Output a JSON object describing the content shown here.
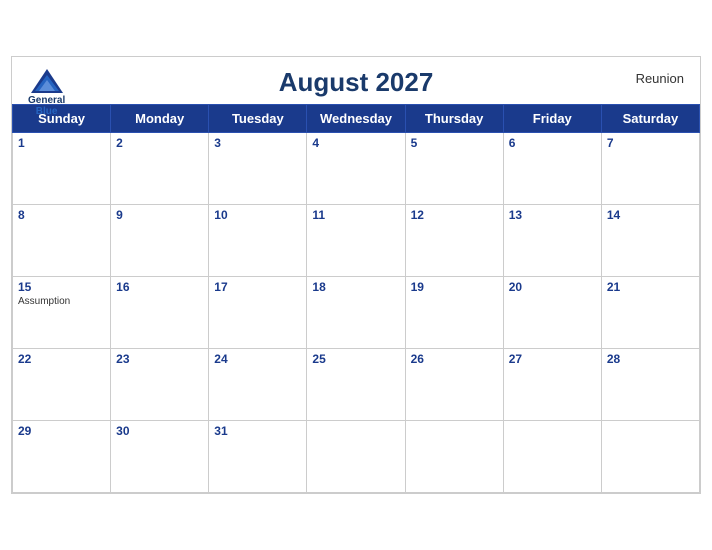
{
  "header": {
    "title": "August 2027",
    "region": "Reunion",
    "logo_general": "General",
    "logo_blue": "Blue"
  },
  "weekdays": [
    "Sunday",
    "Monday",
    "Tuesday",
    "Wednesday",
    "Thursday",
    "Friday",
    "Saturday"
  ],
  "weeks": [
    [
      {
        "date": "1",
        "holiday": ""
      },
      {
        "date": "2",
        "holiday": ""
      },
      {
        "date": "3",
        "holiday": ""
      },
      {
        "date": "4",
        "holiday": ""
      },
      {
        "date": "5",
        "holiday": ""
      },
      {
        "date": "6",
        "holiday": ""
      },
      {
        "date": "7",
        "holiday": ""
      }
    ],
    [
      {
        "date": "8",
        "holiday": ""
      },
      {
        "date": "9",
        "holiday": ""
      },
      {
        "date": "10",
        "holiday": ""
      },
      {
        "date": "11",
        "holiday": ""
      },
      {
        "date": "12",
        "holiday": ""
      },
      {
        "date": "13",
        "holiday": ""
      },
      {
        "date": "14",
        "holiday": ""
      }
    ],
    [
      {
        "date": "15",
        "holiday": "Assumption"
      },
      {
        "date": "16",
        "holiday": ""
      },
      {
        "date": "17",
        "holiday": ""
      },
      {
        "date": "18",
        "holiday": ""
      },
      {
        "date": "19",
        "holiday": ""
      },
      {
        "date": "20",
        "holiday": ""
      },
      {
        "date": "21",
        "holiday": ""
      }
    ],
    [
      {
        "date": "22",
        "holiday": ""
      },
      {
        "date": "23",
        "holiday": ""
      },
      {
        "date": "24",
        "holiday": ""
      },
      {
        "date": "25",
        "holiday": ""
      },
      {
        "date": "26",
        "holiday": ""
      },
      {
        "date": "27",
        "holiday": ""
      },
      {
        "date": "28",
        "holiday": ""
      }
    ],
    [
      {
        "date": "29",
        "holiday": ""
      },
      {
        "date": "30",
        "holiday": ""
      },
      {
        "date": "31",
        "holiday": ""
      },
      {
        "date": "",
        "holiday": ""
      },
      {
        "date": "",
        "holiday": ""
      },
      {
        "date": "",
        "holiday": ""
      },
      {
        "date": "",
        "holiday": ""
      }
    ]
  ]
}
